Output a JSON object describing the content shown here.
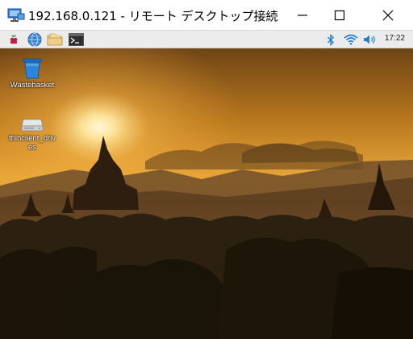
{
  "window": {
    "title": "192.168.0.121 - リモート デスクトップ接続",
    "minimize_icon": "minimize-icon",
    "maximize_icon": "maximize-icon",
    "close_icon": "close-icon"
  },
  "taskbar": {
    "launchers": [
      {
        "name": "raspberry-menu",
        "icon": "raspberry-icon"
      },
      {
        "name": "web-browser",
        "icon": "globe-icon"
      },
      {
        "name": "file-manager",
        "icon": "folder-icon"
      },
      {
        "name": "terminal",
        "icon": "terminal-icon"
      }
    ],
    "tray": {
      "bluetooth_icon": "bluetooth-icon",
      "wifi_icon": "wifi-icon",
      "volume_icon": "volume-icon",
      "clock": "17:22"
    },
    "colors": {
      "bar": "#ececec",
      "tray_blue": "#1f7fd8",
      "raspberry": "#c51a4a"
    }
  },
  "desktop": {
    "icons": [
      {
        "label": "Wastebasket",
        "icon": "trash-icon"
      },
      {
        "label": "thinclient_drives",
        "icon": "drive-icon"
      }
    ]
  }
}
